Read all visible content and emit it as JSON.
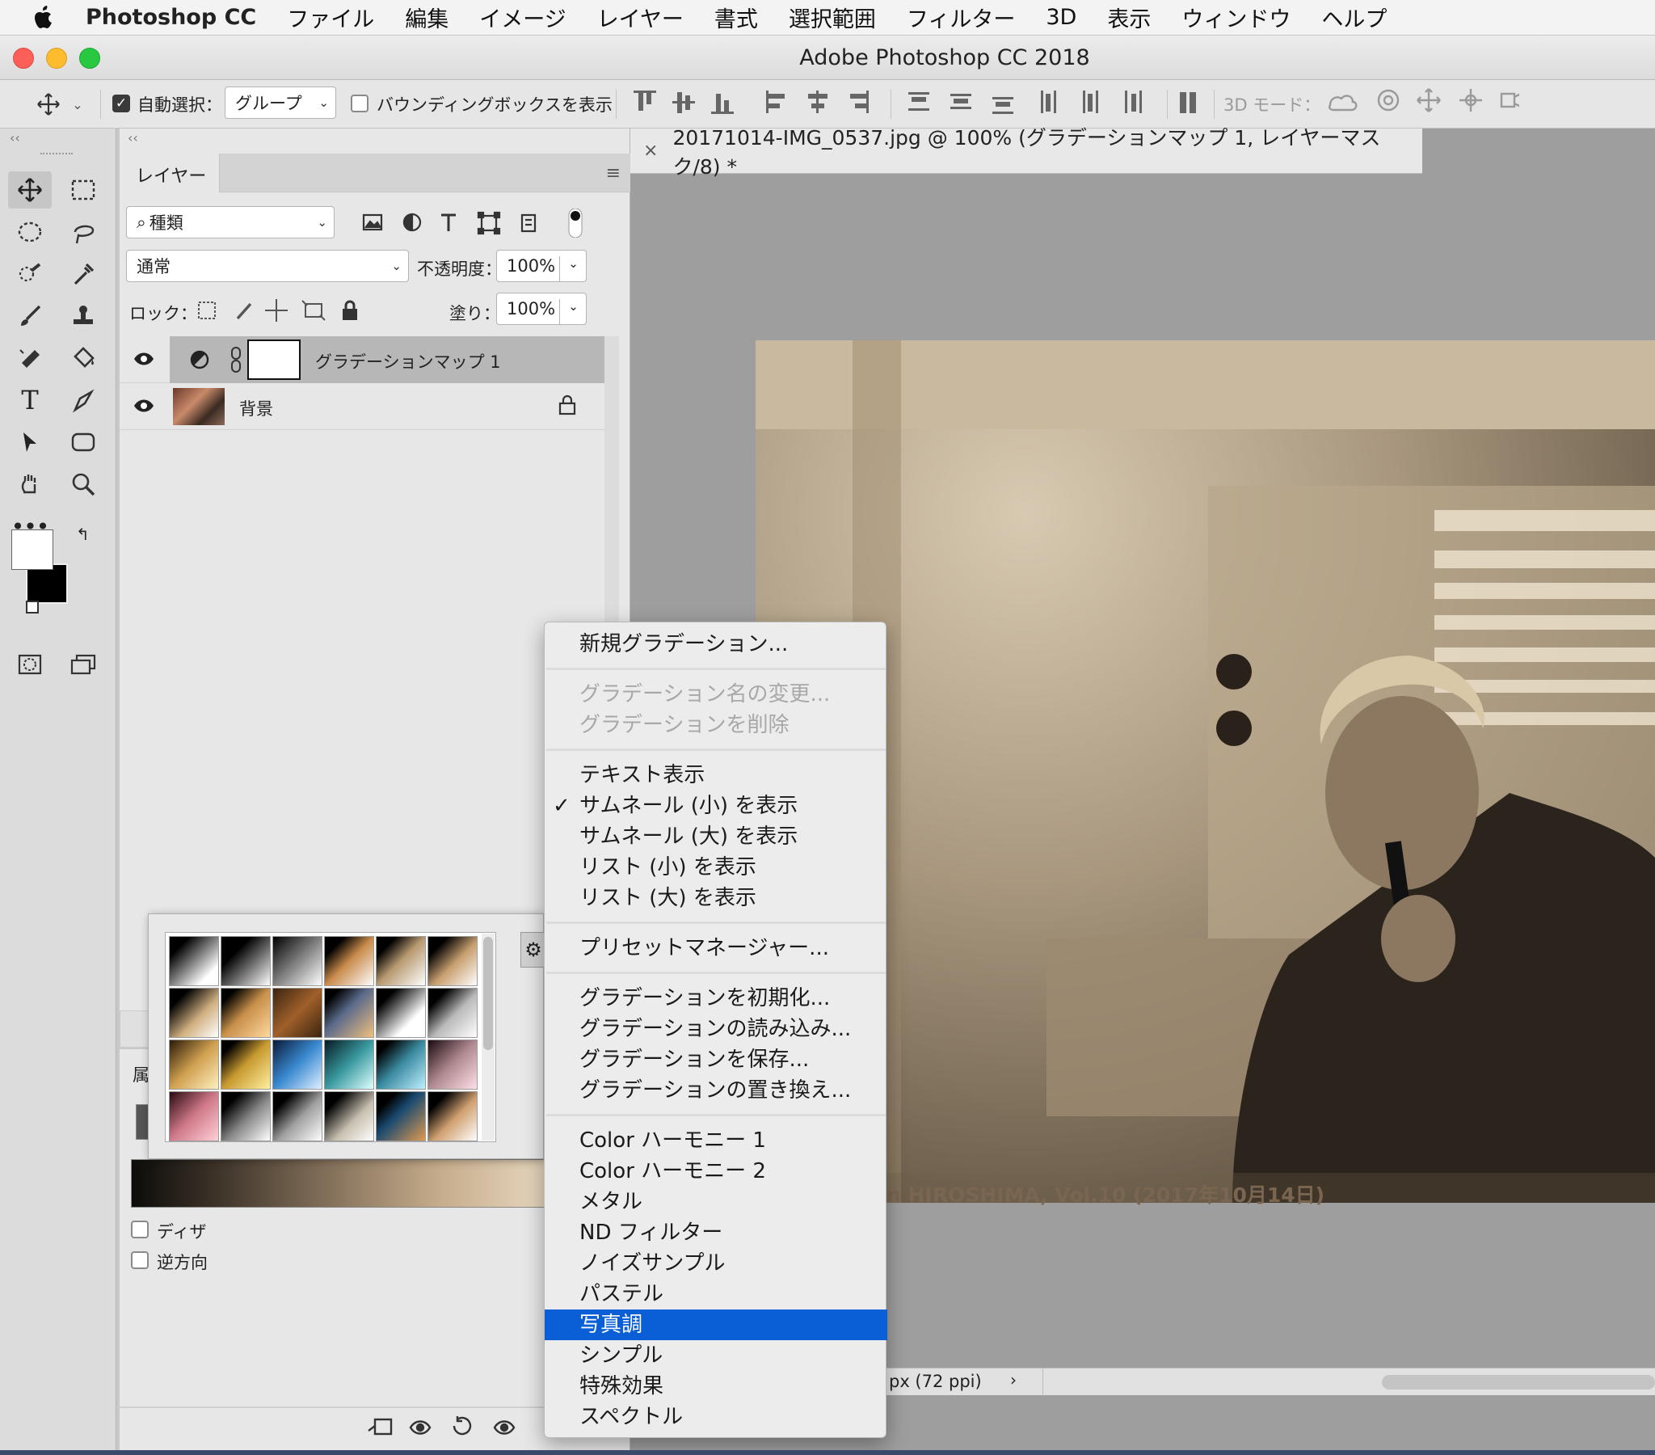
{
  "menubar": {
    "app": "Photoshop CC",
    "items": [
      "ファイル",
      "編集",
      "イメージ",
      "レイヤー",
      "書式",
      "選択範囲",
      "フィルター",
      "3D",
      "表示",
      "ウィンドウ",
      "ヘルプ"
    ]
  },
  "window": {
    "title": "Adobe Photoshop CC 2018"
  },
  "options": {
    "auto_select_label": "自動選択：",
    "auto_select_value": "グループ",
    "bbox_label": "バウンディングボックスを表示",
    "mode3d_label": "3D モード："
  },
  "layers_panel": {
    "tab": "レイヤー",
    "filter_value": "種類",
    "blend_mode": "通常",
    "opacity_label": "不透明度：",
    "opacity_value": "100%",
    "lock_label": "ロック：",
    "fill_label": "塗り：",
    "fill_value": "100%",
    "layers": [
      {
        "name": "グラデーションマップ 1",
        "selected": true
      },
      {
        "name": "背景",
        "locked": true
      }
    ]
  },
  "document": {
    "tab": "20171014-IMG_0537.jpg @ 100% (グラデーションマップ 1, レイヤーマスク/8) *",
    "watermark": "n HIROSHIMA, Vol.10 (2017年10月14日)",
    "status": "px (72 ppi)"
  },
  "properties": {
    "label_cut": "属",
    "dither": "ディザ",
    "reverse": "逆方向"
  },
  "context_menu": {
    "new": "新規グラデーション...",
    "rename": "グラデーション名の変更...",
    "delete": "グラデーションを削除",
    "text_only": "テキスト表示",
    "small_thumb": "サムネール (小) を表示",
    "large_thumb": "サムネール (大) を表示",
    "small_list": "リスト (小) を表示",
    "large_list": "リスト (大) を表示",
    "preset_manager": "プリセットマネージャー...",
    "reset": "グラデーションを初期化...",
    "load": "グラデーションの読み込み...",
    "save": "グラデーションを保存...",
    "replace": "グラデーションの置き換え...",
    "sets": [
      "Color ハーモニー 1",
      "Color ハーモニー 2",
      "メタル",
      "ND フィルター",
      "ノイズサンプル",
      "パステル",
      "写真調",
      "シンプル",
      "特殊効果",
      "スペクトル"
    ],
    "highlighted": "写真調",
    "checkmark": "✓"
  },
  "colors": {
    "highlight": "#0a5fd6",
    "accent_sepia": "#7a6650"
  }
}
